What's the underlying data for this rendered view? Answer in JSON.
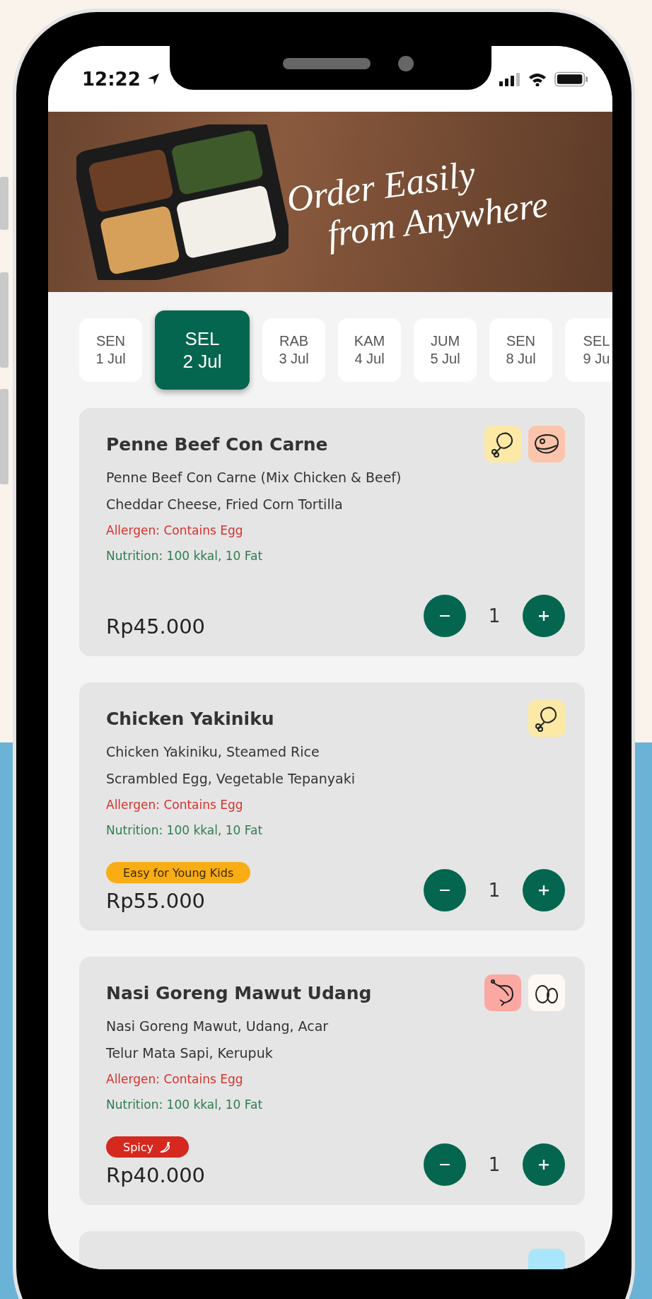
{
  "status_bar": {
    "time": "12:22"
  },
  "banner": {
    "headline": [
      "Order Easily",
      "from Anywhere"
    ]
  },
  "dates": [
    {
      "day": "SEN",
      "date": "1 Jul",
      "selected": false
    },
    {
      "day": "SEL",
      "date": "2 Jul",
      "selected": true
    },
    {
      "day": "RAB",
      "date": "3 Jul",
      "selected": false
    },
    {
      "day": "KAM",
      "date": "4 Jul",
      "selected": false
    },
    {
      "day": "JUM",
      "date": "5 Jul",
      "selected": false
    },
    {
      "day": "SEN",
      "date": "8 Jul",
      "selected": false
    },
    {
      "day": "SEL",
      "date": "9 Ju",
      "selected": false
    }
  ],
  "menu_items": [
    {
      "name": "Penne Beef Con Carne",
      "description": [
        "Penne Beef Con Carne (Mix Chicken & Beef)",
        "Cheddar Cheese, Fried Corn Tortilla"
      ],
      "allergen": "Allergen: Contains Egg",
      "nutrition": "Nutrition: 100 kkal, 10 Fat",
      "price": "Rp45.000",
      "quantity": "1",
      "icons": [
        {
          "kind": "chicken",
          "color": "#fde9a6"
        },
        {
          "kind": "beef",
          "color": "#fbc4ab"
        }
      ]
    },
    {
      "name": "Chicken Yakiniku",
      "description": [
        "Chicken Yakiniku, Steamed Rice",
        "Scrambled Egg, Vegetable Tepanyaki"
      ],
      "allergen": "Allergen: Contains Egg",
      "nutrition": "Nutrition: 100 kkal, 10 Fat",
      "tag": {
        "kind": "kids",
        "label": "Easy for Young Kids"
      },
      "price": "Rp55.000",
      "quantity": "1",
      "icons": [
        {
          "kind": "chicken",
          "color": "#fde9a6"
        }
      ]
    },
    {
      "name": "Nasi Goreng Mawut Udang",
      "description": [
        "Nasi Goreng Mawut, Udang, Acar",
        "Telur Mata Sapi, Kerupuk"
      ],
      "allergen": "Allergen: Contains Egg",
      "nutrition": "Nutrition: 100 kkal, 10 Fat",
      "tag": {
        "kind": "spicy",
        "label": "Spicy"
      },
      "price": "Rp40.000",
      "quantity": "1",
      "icons": [
        {
          "kind": "shrimp",
          "color": "#fba8a3"
        },
        {
          "kind": "egg",
          "color": "#fdf8f2"
        }
      ]
    },
    {
      "icons": [
        {
          "kind": "other",
          "color": "#a9e5fb"
        }
      ]
    }
  ]
}
